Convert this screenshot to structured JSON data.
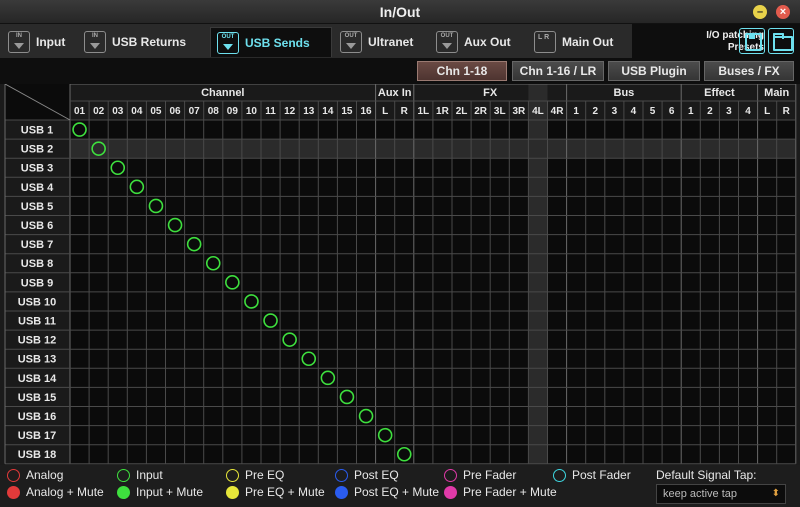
{
  "window": {
    "title": "In/Out"
  },
  "tabs": [
    {
      "label": "Input",
      "icon_text": "IN",
      "icon": "input-icon"
    },
    {
      "label": "USB Returns",
      "icon_text": "IN",
      "icon": "usb-returns-icon"
    },
    {
      "label": "USB Sends",
      "icon_text": "OUT",
      "icon": "usb-sends-icon"
    },
    {
      "label": "Ultranet",
      "icon_text": "OUT",
      "icon": "ultranet-icon"
    },
    {
      "label": "Aux Out",
      "icon_text": "OUT",
      "icon": "aux-out-icon"
    },
    {
      "label": "Main Out",
      "icon_text": "L R",
      "icon": "main-out-icon"
    }
  ],
  "active_tab": "USB Sends",
  "presets": {
    "label_line1": "I/O patching",
    "label_line2": "Presets"
  },
  "source_buttons": [
    {
      "label": "Chn 1-18",
      "active": true
    },
    {
      "label": "Chn 1-16 / LR",
      "active": false
    },
    {
      "label": "USB Plugin",
      "active": false
    },
    {
      "label": "Buses / FX",
      "active": false
    }
  ],
  "matrix": {
    "groups": [
      {
        "label": "Channel",
        "columns": [
          "01",
          "02",
          "03",
          "04",
          "05",
          "06",
          "07",
          "08",
          "09",
          "10",
          "11",
          "12",
          "13",
          "14",
          "15",
          "16"
        ]
      },
      {
        "label": "Aux In",
        "columns": [
          "L",
          "R"
        ]
      },
      {
        "label": "FX",
        "columns": [
          "1L",
          "1R",
          "2L",
          "2R",
          "3L",
          "3R",
          "4L",
          "4R"
        ]
      },
      {
        "label": "Bus",
        "columns": [
          "1",
          "2",
          "3",
          "4",
          "5",
          "6"
        ]
      },
      {
        "label": "Effect",
        "columns": [
          "1",
          "2",
          "3",
          "4"
        ]
      },
      {
        "label": "Main",
        "columns": [
          "L",
          "R"
        ]
      }
    ],
    "rows": [
      "USB 1",
      "USB 2",
      "USB 3",
      "USB 4",
      "USB 5",
      "USB 6",
      "USB 7",
      "USB 8",
      "USB 9",
      "USB 10",
      "USB 11",
      "USB 12",
      "USB 13",
      "USB 14",
      "USB 15",
      "USB 16",
      "USB 17",
      "USB 18"
    ],
    "highlighted_row": "USB 2",
    "highlighted_column": "4L",
    "routes": [
      {
        "row": 0,
        "col": 0
      },
      {
        "row": 1,
        "col": 1
      },
      {
        "row": 2,
        "col": 2
      },
      {
        "row": 3,
        "col": 3
      },
      {
        "row": 4,
        "col": 4
      },
      {
        "row": 5,
        "col": 5
      },
      {
        "row": 6,
        "col": 6
      },
      {
        "row": 7,
        "col": 7
      },
      {
        "row": 8,
        "col": 8
      },
      {
        "row": 9,
        "col": 9
      },
      {
        "row": 10,
        "col": 10
      },
      {
        "row": 11,
        "col": 11
      },
      {
        "row": 12,
        "col": 12
      },
      {
        "row": 13,
        "col": 13
      },
      {
        "row": 14,
        "col": 14
      },
      {
        "row": 15,
        "col": 15
      },
      {
        "row": 16,
        "col": 16
      },
      {
        "row": 17,
        "col": 17
      }
    ],
    "route_tap": "Input",
    "route_color": "#3ee03e"
  },
  "legend": [
    {
      "label": "Analog",
      "color": "#e23a3a",
      "style": "ring"
    },
    {
      "label": "Input",
      "color": "#3ee03e",
      "style": "ring"
    },
    {
      "label": "Pre EQ",
      "color": "#e6e63a",
      "style": "ring"
    },
    {
      "label": "Post EQ",
      "color": "#2a5cf0",
      "style": "ring"
    },
    {
      "label": "Pre Fader",
      "color": "#e03aa8",
      "style": "ring"
    },
    {
      "label": "Post Fader",
      "color": "#3ed6e0",
      "style": "ring"
    },
    {
      "label": "Analog + Mute",
      "color": "#e23a3a",
      "style": "dot"
    },
    {
      "label": "Input + Mute",
      "color": "#3ee03e",
      "style": "dot"
    },
    {
      "label": "Pre EQ + Mute",
      "color": "#e6e63a",
      "style": "dot"
    },
    {
      "label": "Post EQ + Mute",
      "color": "#2a5cf0",
      "style": "dot"
    },
    {
      "label": "Pre Fader + Mute",
      "color": "#e03aa8",
      "style": "dot"
    }
  ],
  "default_tap": {
    "label": "Default Signal Tap:",
    "value": "keep active tap"
  }
}
